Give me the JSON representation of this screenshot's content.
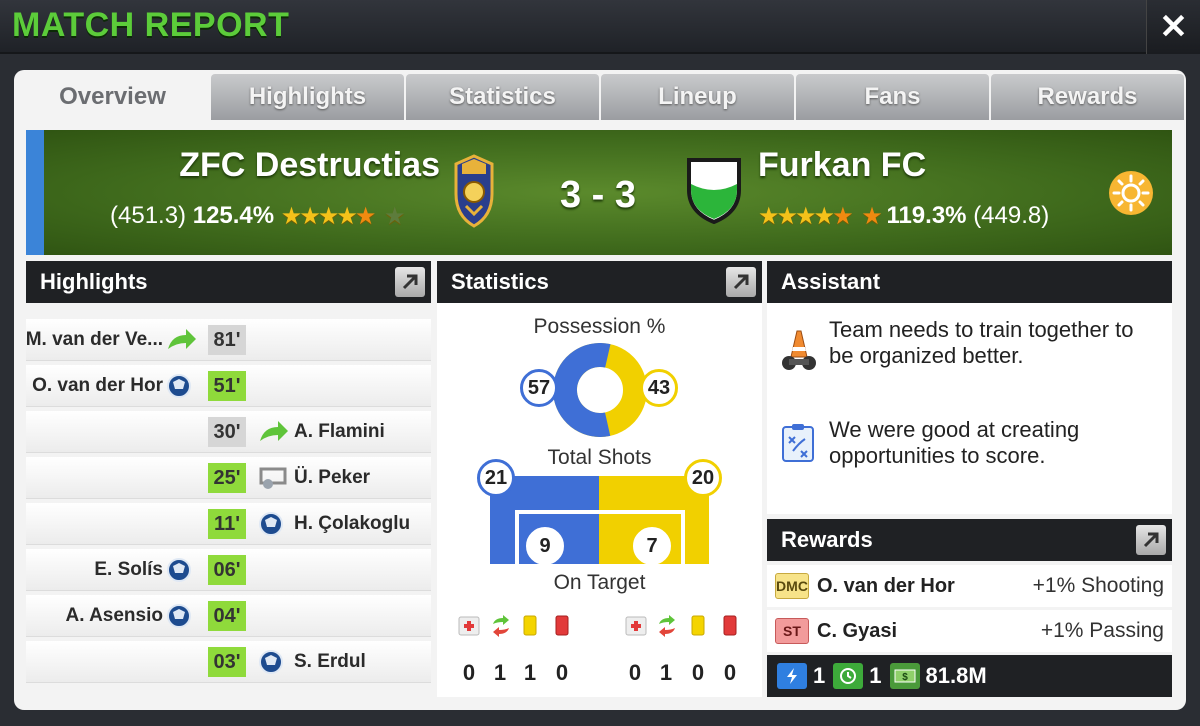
{
  "header": {
    "title": "MATCH REPORT",
    "close_icon": "close-icon"
  },
  "tabs": [
    {
      "label": "Overview",
      "active": true
    },
    {
      "label": "Highlights",
      "active": false
    },
    {
      "label": "Statistics",
      "active": false
    },
    {
      "label": "Lineup",
      "active": false
    },
    {
      "label": "Fans",
      "active": false
    },
    {
      "label": "Rewards",
      "active": false
    }
  ],
  "match": {
    "home": {
      "name": "ZFC Destructias",
      "rating_raw": "(451.3)",
      "rating_pct": "125.4%",
      "stars": "★★★★★"
    },
    "away": {
      "name": "Furkan FC",
      "rating_raw": "(449.8)",
      "rating_pct": "119.3%",
      "stars": "★★★★★"
    },
    "score": "3 - 3",
    "weather_icon": "sun-icon"
  },
  "highlights": {
    "title": "Highlights",
    "rows": [
      {
        "side": "home",
        "player": "M. van der Ve...",
        "minute": "81'",
        "event": "substitution-icon",
        "minute_style": "grey"
      },
      {
        "side": "home",
        "player": "O. van der Hor",
        "minute": "51'",
        "event": "goal-icon",
        "minute_style": "green"
      },
      {
        "side": "away",
        "player": "A. Flamini",
        "minute": "30'",
        "event": "substitution-icon",
        "minute_style": "grey"
      },
      {
        "side": "away",
        "player": "Ü. Peker",
        "minute": "25'",
        "event": "missed-shot-icon",
        "minute_style": "green"
      },
      {
        "side": "away",
        "player": "H. Çolakoglu",
        "minute": "11'",
        "event": "goal-icon",
        "minute_style": "green"
      },
      {
        "side": "home",
        "player": "E. Solís",
        "minute": "06'",
        "event": "goal-icon",
        "minute_style": "green"
      },
      {
        "side": "home",
        "player": "A. Asensio",
        "minute": "04'",
        "event": "goal-icon",
        "minute_style": "green"
      },
      {
        "side": "away",
        "player": "S. Erdul",
        "minute": "03'",
        "event": "goal-icon",
        "minute_style": "green"
      }
    ]
  },
  "statistics": {
    "title": "Statistics",
    "possession_label": "Possession %",
    "possession_home": "57",
    "possession_away": "43",
    "possession_home_value": 57,
    "total_shots_label": "Total Shots",
    "shots_home": "21",
    "shots_away": "20",
    "on_target_label": "On Target",
    "on_target_home": "9",
    "on_target_away": "7",
    "home_color": "#3f6fd6",
    "away_color": "#f1d000",
    "cards_home": [
      "0",
      "1",
      "1",
      "0"
    ],
    "cards_away": [
      "0",
      "1",
      "0",
      "0"
    ]
  },
  "assistant": {
    "title": "Assistant",
    "tips": [
      {
        "icon": "training-cone-icon",
        "text": "Team needs to train together to be organized better."
      },
      {
        "icon": "tactics-board-icon",
        "text": "We were good at creating opportunities to score."
      }
    ]
  },
  "rewards": {
    "title": "Rewards",
    "rows": [
      {
        "position": "DMC",
        "player": "O. van der Hor",
        "bonus": "+1% Shooting"
      },
      {
        "position": "ST",
        "player": "C. Gyasi",
        "bonus": "+1% Passing"
      }
    ],
    "totals": {
      "energy": "1",
      "training": "1",
      "money": "81.8M"
    }
  }
}
